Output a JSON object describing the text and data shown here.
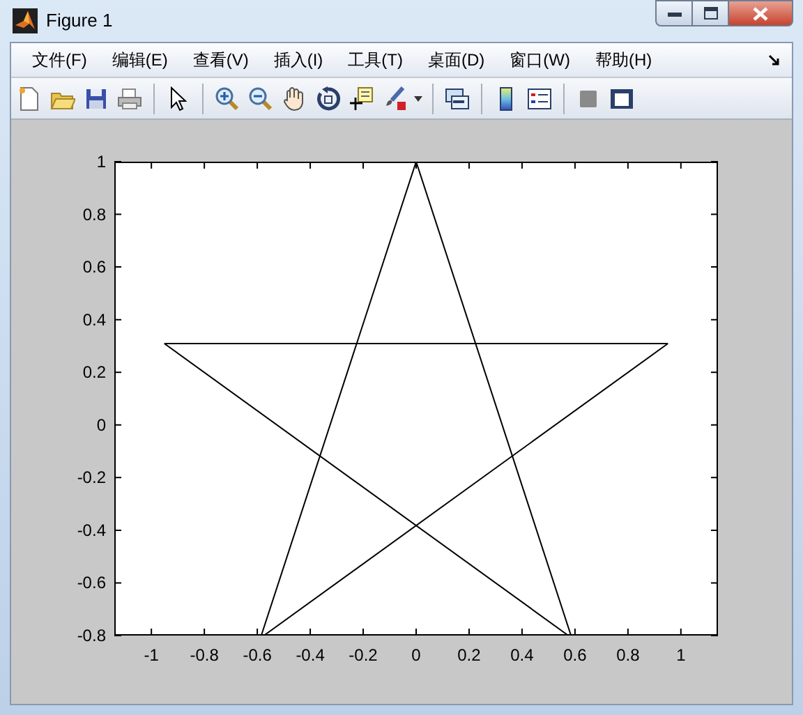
{
  "window": {
    "title": "Figure 1"
  },
  "menu": [
    {
      "label": "文件(F)"
    },
    {
      "label": "编辑(E)"
    },
    {
      "label": "查看(V)"
    },
    {
      "label": "插入(I)"
    },
    {
      "label": "工具(T)"
    },
    {
      "label": "桌面(D)"
    },
    {
      "label": "窗口(W)"
    },
    {
      "label": "帮助(H)"
    }
  ],
  "axes": {
    "chart_data": {
      "type": "line",
      "series": [
        {
          "color": "#000000",
          "x": [
            0,
            0.585
          ],
          "values": [
            1,
            -0.8
          ]
        },
        {
          "color": "#000000",
          "x": [
            -0.9511,
            0.575
          ],
          "values": [
            0.309,
            -0.8
          ]
        },
        {
          "color": "#000000",
          "x": [
            -0.9511,
            0.9511
          ],
          "values": [
            0.309,
            0.309
          ]
        },
        {
          "color": "#000000",
          "x": [
            -0.575,
            0.9511
          ],
          "values": [
            -0.8,
            0.309
          ]
        },
        {
          "color": "#000000",
          "x": [
            -0.585,
            0
          ],
          "values": [
            -0.8,
            1
          ]
        }
      ],
      "xlim": [
        -1.14,
        1.14
      ],
      "ylim": [
        -0.8,
        1
      ],
      "xticks": [
        -1,
        -0.8,
        -0.6,
        -0.4,
        -0.2,
        0,
        0.2,
        0.4,
        0.6,
        0.8,
        1
      ],
      "yticks": [
        -0.8,
        -0.6,
        -0.4,
        -0.2,
        0,
        0.2,
        0.4,
        0.6,
        0.8,
        1
      ]
    }
  }
}
